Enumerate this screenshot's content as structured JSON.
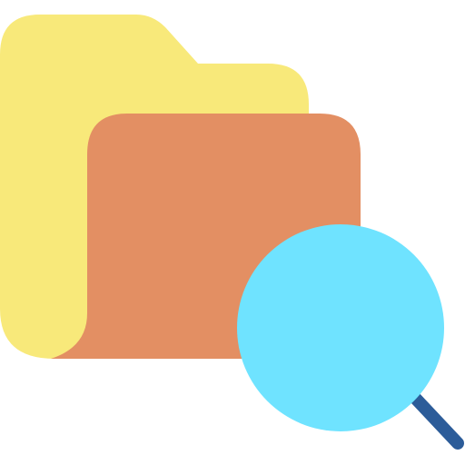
{
  "icon": {
    "name": "folder-search-icon",
    "colors": {
      "folder_back": "#F8E97A",
      "folder_front": "#E38F63",
      "lens": "#6FE3FF",
      "handle": "#2C5C99"
    }
  }
}
